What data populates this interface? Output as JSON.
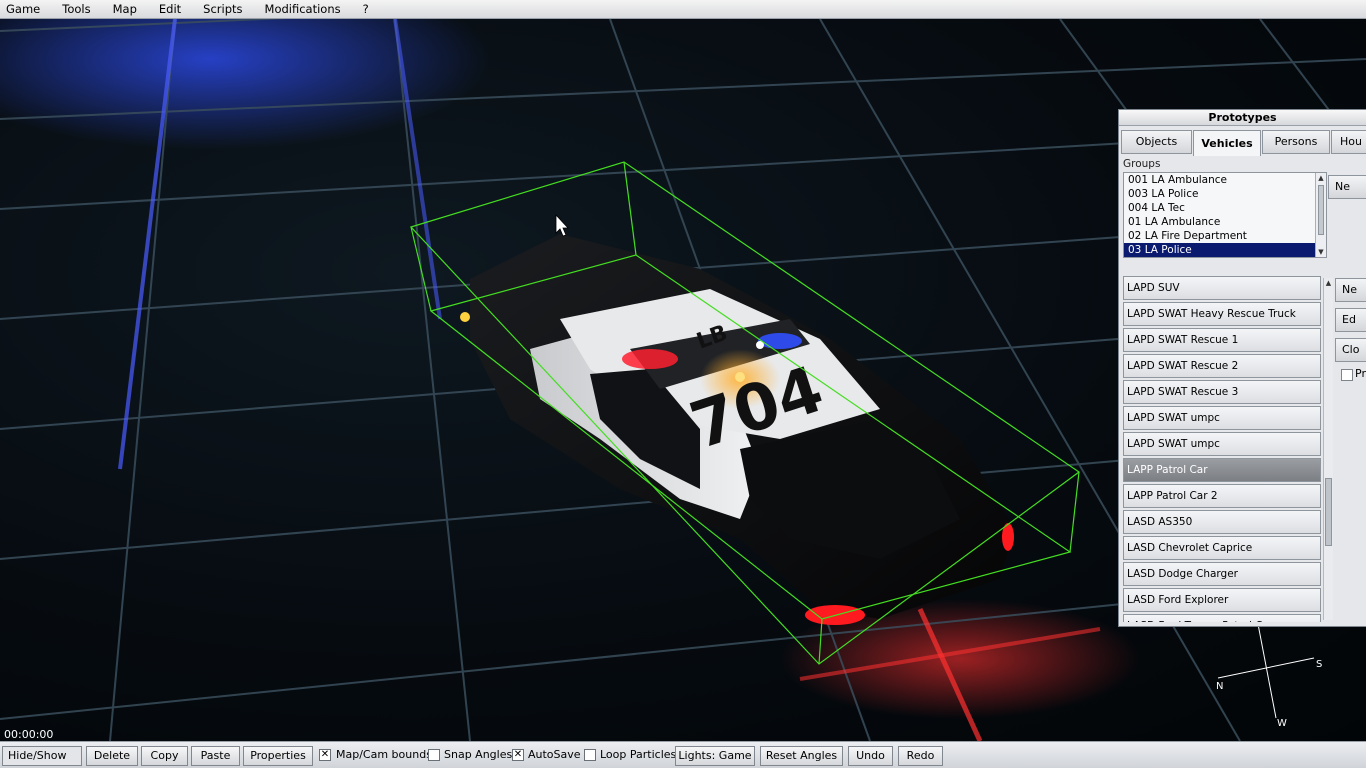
{
  "menubar": {
    "items": [
      "Game",
      "Tools",
      "Map",
      "Edit",
      "Scripts",
      "Modifications",
      "?"
    ]
  },
  "viewport": {
    "car_roof_text": "LB",
    "car_number": "704",
    "timer": "00:00:00"
  },
  "prototypes": {
    "title": "Prototypes",
    "tabs": [
      "Objects",
      "Vehicles",
      "Persons",
      "Hou"
    ],
    "active_tab": "Vehicles",
    "groups_label": "Groups",
    "groups": [
      "001 LA Ambulance",
      "003 LA Police",
      "004 LA Tec",
      "01 LA Ambulance",
      "02 LA Fire Department",
      "03 LA Police"
    ],
    "selected_group": "03 LA Police",
    "group_side_button": "Ne",
    "items": [
      "LAPD SUV",
      "LAPD SWAT Heavy Rescue Truck",
      "LAPD SWAT Rescue 1",
      "LAPD SWAT Rescue 2",
      "LAPD SWAT Rescue 3",
      "LAPD SWAT umpc",
      "LAPD SWAT umpc",
      "LAPP Patrol Car",
      "LAPP Patrol Car 2",
      "LASD AS350",
      "LASD Chevrolet Caprice",
      "LASD Dodge Charger",
      "LASD Ford Explorer",
      "LASD Ford Taurus Patrol Car"
    ],
    "highlighted_item": "LAPP Patrol Car",
    "item_side_buttons": [
      "Ne",
      "Ed",
      "Clo"
    ],
    "item_side_checkbox": "Pre"
  },
  "compass": {
    "labels": [
      "S",
      "N",
      "W"
    ]
  },
  "toolbar": {
    "hide_show": "Hide/Show",
    "delete": "Delete",
    "copy": "Copy",
    "paste": "Paste",
    "properties": "Properties",
    "map_cam_bounds": "Map/Cam bounds",
    "map_cam_bounds_checked": true,
    "snap_angles": "Snap Angles",
    "snap_angles_checked": false,
    "autosave": "AutoSave",
    "autosave_checked": true,
    "loop_particles": "Loop Particles",
    "loop_particles_checked": false,
    "lights": "Lights: Game",
    "reset_angles": "Reset Angles",
    "undo": "Undo",
    "redo": "Redo"
  },
  "colors": {
    "grid_line": "#3a4e5c",
    "blue_light": "#2040ff",
    "red_light": "#ff2020",
    "bounding_box": "#44dd22",
    "selected_group_bg": "#0a1a6e"
  }
}
